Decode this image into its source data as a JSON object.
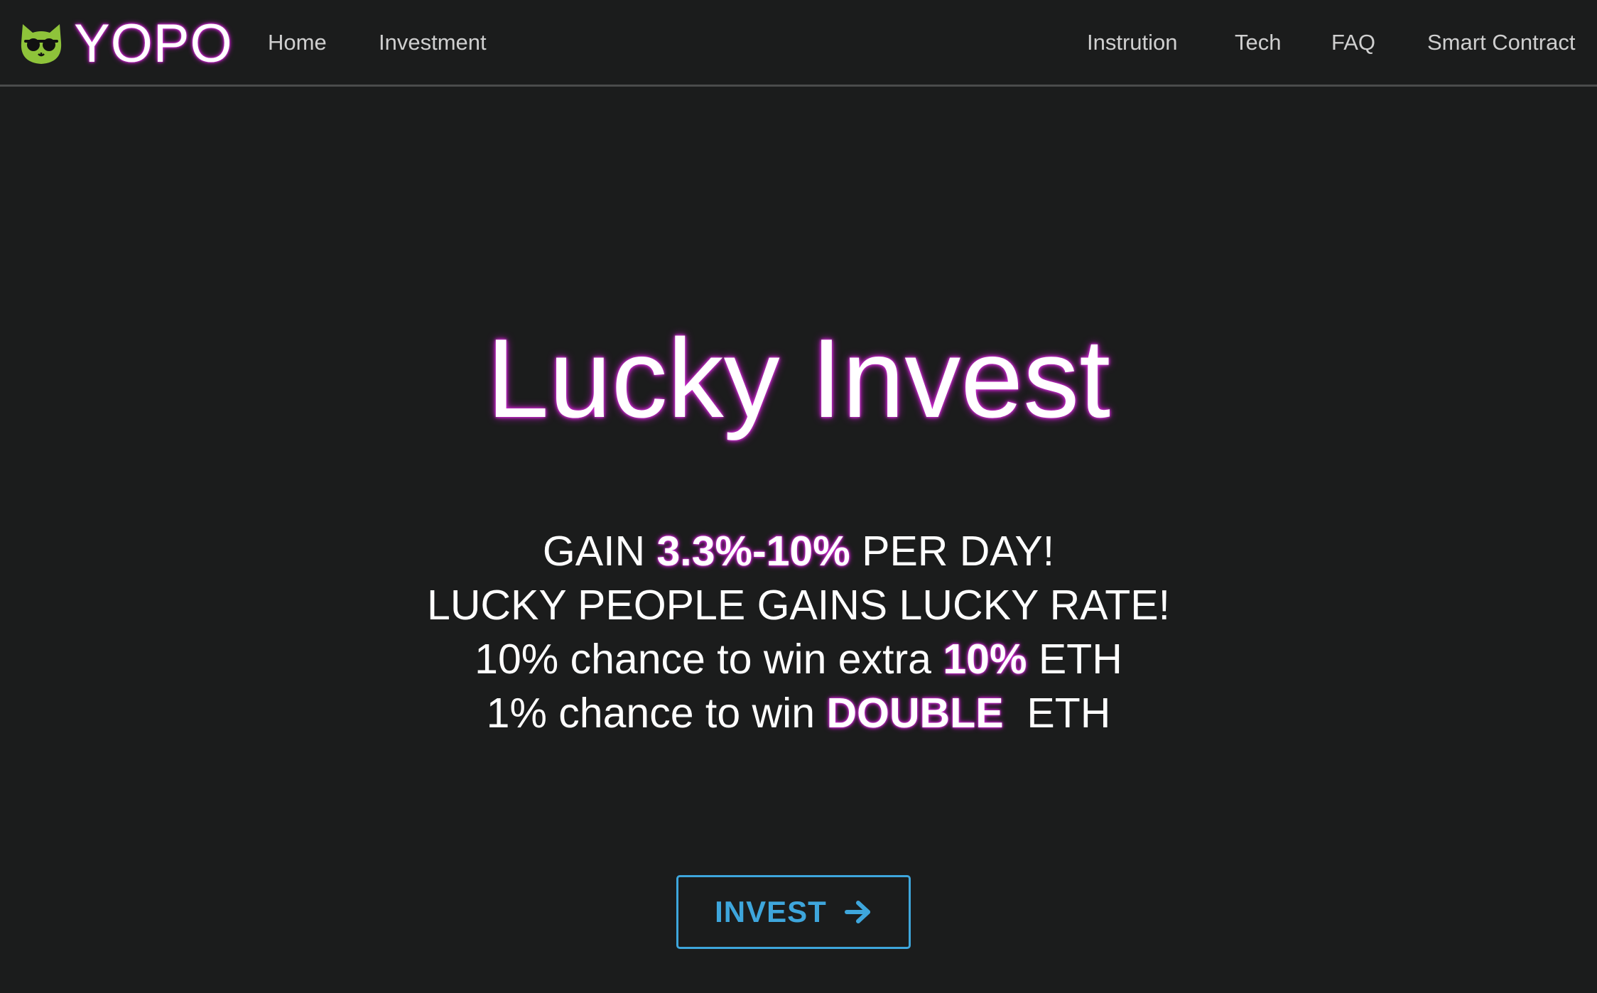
{
  "brand": {
    "name": "YOPO",
    "logo_icon": "cat-sunglasses-icon",
    "logo_color": "#8ec33a",
    "glow_color": "#d22bd6"
  },
  "nav": {
    "left_items": [
      {
        "label": "Home"
      },
      {
        "label": "Investment"
      }
    ],
    "right_items": [
      {
        "label": "Instrution"
      },
      {
        "label": "Tech"
      },
      {
        "label": "FAQ"
      },
      {
        "label": "Smart Contract"
      }
    ]
  },
  "hero": {
    "title": "Lucky Invest",
    "line1": {
      "pre": "GAIN ",
      "highlight": "3.3%-10%",
      "post": " PER DAY!"
    },
    "line2": "LUCKY PEOPLE GAINS LUCKY RATE!",
    "line3": {
      "pre": "10% chance to win extra ",
      "highlight": "10%",
      "post": " ETH"
    },
    "line4": {
      "pre": "1% chance to win ",
      "highlight": "DOUBLE",
      "post": "  ETH"
    }
  },
  "cta": {
    "label": "INVEST",
    "icon": "arrow-right-icon",
    "color": "#3ea6dc"
  },
  "colors": {
    "background": "#1b1c1c",
    "nav_text": "#cfcfcf",
    "divider": "#4a4b4b"
  }
}
